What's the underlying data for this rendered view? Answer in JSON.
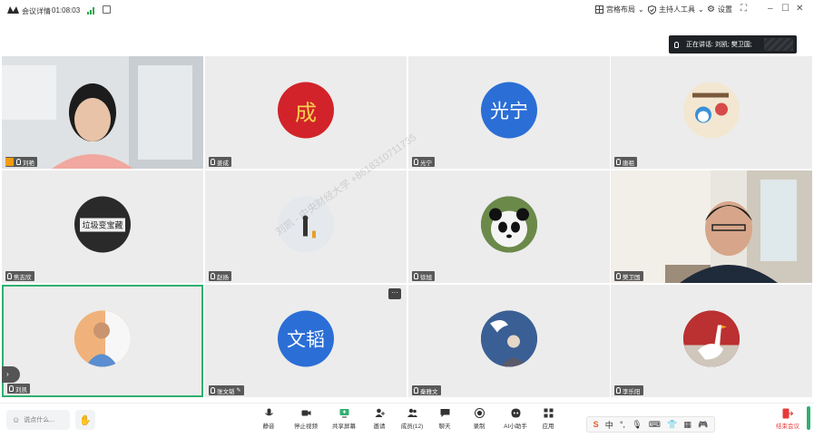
{
  "topbar": {
    "meeting_details": "会议详情",
    "timer": "01:08:03",
    "layout_label": "宫格布局",
    "host_tools_label": "主持人工具",
    "settings_label": "设置"
  },
  "speaking": {
    "label": "正在讲话:",
    "names": "刘凯; 樊卫国;"
  },
  "participants": [
    {
      "name": "刘艳",
      "avatar_text": ""
    },
    {
      "name": "姜成",
      "avatar_text": "成"
    },
    {
      "name": "光宁",
      "avatar_text": "光宁"
    },
    {
      "name": "唐祖",
      "avatar_text": ""
    },
    {
      "name": "焦志欣",
      "avatar_text": "垃圾变宝藏"
    },
    {
      "name": "赵扬",
      "avatar_text": ""
    },
    {
      "name": "徐旭",
      "avatar_text": ""
    },
    {
      "name": "樊卫国",
      "avatar_text": ""
    },
    {
      "name": "刘凯",
      "avatar_text": ""
    },
    {
      "name": "张文韬",
      "avatar_text": "文韬"
    },
    {
      "name": "秦雅文",
      "avatar_text": ""
    },
    {
      "name": "李乐阳",
      "avatar_text": ""
    }
  ],
  "watermark": "刘凯 - 中央财经大学 +8618310711735",
  "bottombar": {
    "say_placeholder": "说点什么...",
    "tools": [
      {
        "label": "静音",
        "icon": "mic-icon"
      },
      {
        "label": "停止视频",
        "icon": "camera-icon"
      },
      {
        "label": "共享屏幕",
        "icon": "share-screen-icon"
      },
      {
        "label": "邀请",
        "icon": "invite-icon"
      },
      {
        "label": "成员(12)",
        "icon": "members-icon"
      },
      {
        "label": "聊天",
        "icon": "chat-icon"
      },
      {
        "label": "录制",
        "icon": "record-icon"
      },
      {
        "label": "AI小助手",
        "icon": "ai-assistant-icon"
      },
      {
        "label": "应用",
        "icon": "apps-icon"
      }
    ],
    "ime_lang": "中",
    "end_label": "结束会议"
  },
  "colors": {
    "accent_green": "#2fb070",
    "avatar_blue": "#2b6ed6",
    "end_red": "#e5393a"
  }
}
